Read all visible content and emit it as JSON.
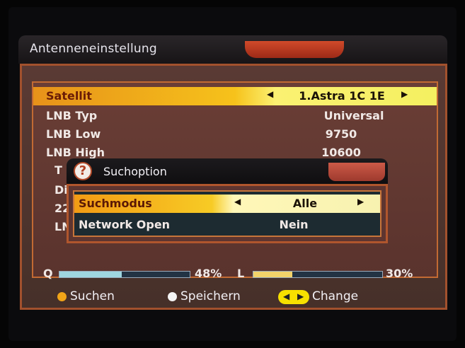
{
  "header": {
    "title": "Antenneneinstellung"
  },
  "settings": {
    "rows": [
      {
        "label": "Satellit",
        "value": "1.Astra 1C 1E"
      },
      {
        "label": "LNB Typ",
        "value": "Universal"
      },
      {
        "label": "LNB Low",
        "value": "9750"
      },
      {
        "label": "LNB High",
        "value": "10600"
      }
    ],
    "hidden_partial": [
      "T",
      "Di",
      "22",
      "LN"
    ]
  },
  "signal": {
    "quality_label": "Q",
    "quality_percent": 48,
    "quality_text": "48%",
    "level_label": "L",
    "level_percent": 30,
    "level_text": "30%"
  },
  "footer": {
    "search_label": "Suchen",
    "save_label": "Speichern",
    "change_label": "Change"
  },
  "dialog": {
    "title": "Suchoption",
    "rows": [
      {
        "label": "Suchmodus",
        "value": "Alle"
      },
      {
        "label": "Network Open",
        "value": "Nein"
      }
    ]
  },
  "colors": {
    "accent_orange": "#e7921a",
    "highlight_yellow": "#f6c21b",
    "panel_border": "#c26a33",
    "header_tab_red": "#b0381f",
    "quality_fill": "#9fd6e0",
    "level_fill": "#f3d36a"
  },
  "icons": {
    "dialog_icon": "question-icon",
    "left_arrow": "arrow-left-icon",
    "right_arrow": "arrow-right-icon"
  }
}
